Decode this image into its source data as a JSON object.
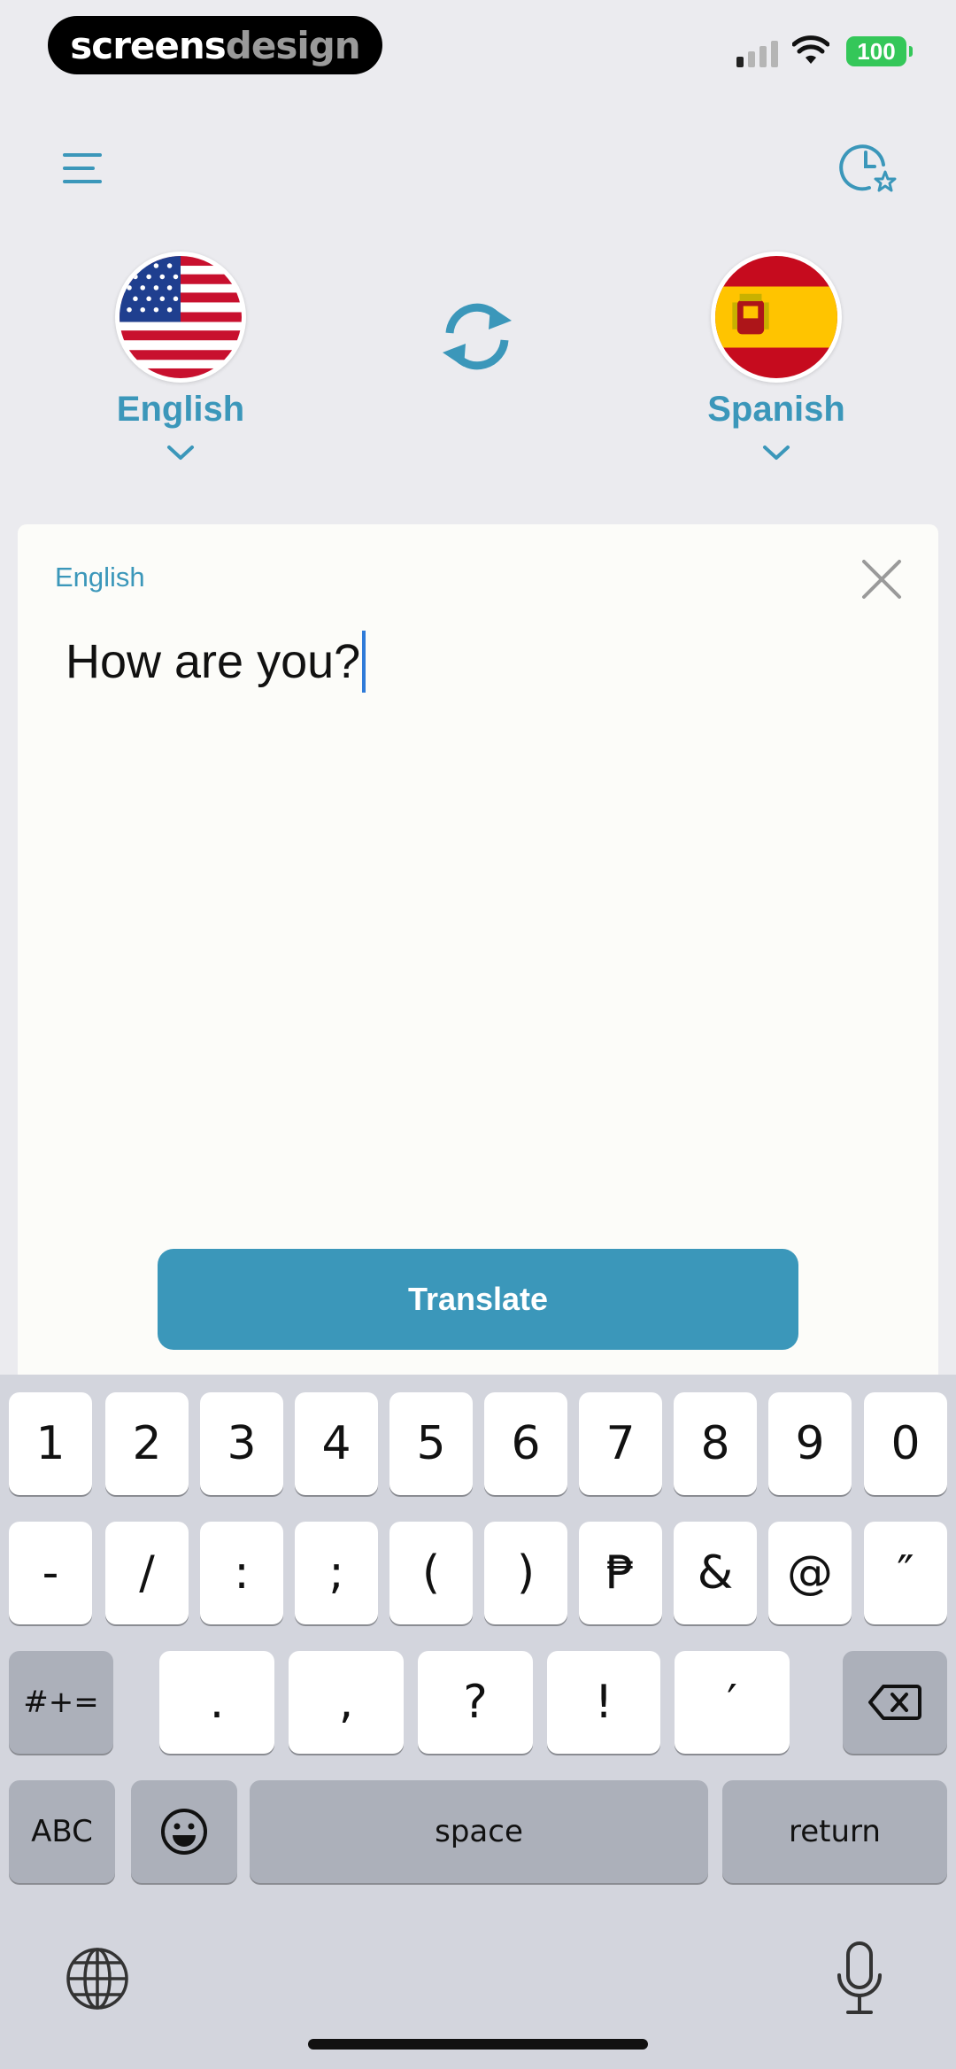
{
  "watermark": {
    "part1": "screens",
    "part2": "design"
  },
  "status": {
    "battery": "100"
  },
  "languages": {
    "source": "English",
    "target": "Spanish"
  },
  "input": {
    "language_label": "English",
    "text": "How are you?"
  },
  "actions": {
    "translate": "Translate"
  },
  "keyboard": {
    "row1": [
      "1",
      "2",
      "3",
      "4",
      "5",
      "6",
      "7",
      "8",
      "9",
      "0"
    ],
    "row2": [
      "-",
      "/",
      ":",
      ";",
      "(",
      ")",
      "₱",
      "&",
      "@",
      "″"
    ],
    "row3": [
      ".",
      ",",
      "?",
      "!",
      "′"
    ],
    "symbols_toggle": "#+=",
    "abc": "ABC",
    "space": "space",
    "return": "return"
  },
  "colors": {
    "accent": "#3b97ba",
    "background": "#ebebef",
    "card": "#fcfcf9",
    "keyboard": "#d3d5dd"
  },
  "icons": [
    "menu-icon",
    "history-star-icon",
    "us-flag-icon",
    "spain-flag-icon",
    "swap-icon",
    "close-icon",
    "backspace-icon",
    "emoji-icon",
    "globe-icon",
    "microphone-icon"
  ]
}
